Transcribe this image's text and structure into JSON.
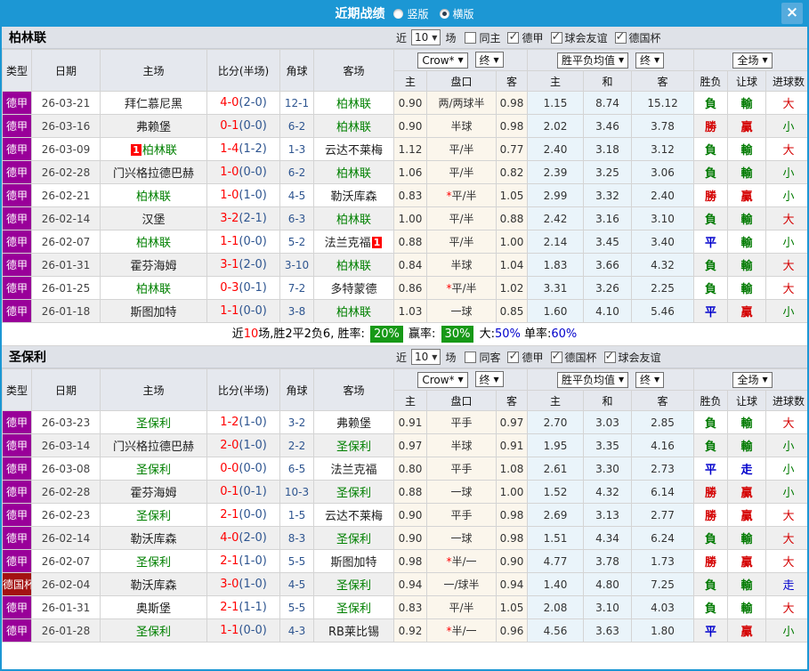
{
  "titlebar": {
    "title": "近期战绩",
    "radios": [
      {
        "label": "竖版",
        "selected": false
      },
      {
        "label": "横版",
        "selected": true
      }
    ],
    "close_glyph": "×"
  },
  "table_header": {
    "left": [
      "类型",
      "日期",
      "主场",
      "比分(半场)",
      "角球",
      "客场"
    ],
    "odds_sub": [
      "主",
      "盘口",
      "客"
    ],
    "avg_sub": [
      "主",
      "和",
      "客"
    ],
    "result_sub": [
      "胜负",
      "让球",
      "进球数"
    ],
    "dd_bookmaker": "Crow*",
    "dd_odds_time": "终",
    "dd_avg": "胜平负均值",
    "dd_avg_time": "终",
    "dd_scope": "全场",
    "arrow": "▼"
  },
  "sections": [
    {
      "team": "柏林联",
      "filters": {
        "near": "近",
        "count": "10",
        "games": "场",
        "same": {
          "label": "同主",
          "checked": false
        },
        "leagues": [
          {
            "label": "德甲",
            "checked": true
          },
          {
            "label": "球会友谊",
            "checked": true
          },
          {
            "label": "德国杯",
            "checked": true
          }
        ]
      },
      "rows": [
        {
          "type": "德甲",
          "cup": false,
          "date": "26-03-21",
          "home": "拜仁慕尼黑",
          "hf": false,
          "hb": null,
          "ft": "4-0",
          "ht": "(2-0)",
          "corner": "12-1",
          "away": "柏林联",
          "af": true,
          "ab": null,
          "odds": [
            "0.90",
            "两/两球半",
            "0.98"
          ],
          "star": false,
          "avg": [
            "1.15",
            "8.74",
            "15.12"
          ],
          "res": [
            [
              "負",
              "g"
            ],
            [
              "輸",
              "g"
            ],
            [
              "大",
              "r"
            ]
          ]
        },
        {
          "type": "德甲",
          "cup": false,
          "date": "26-03-16",
          "home": "弗赖堡",
          "hf": false,
          "hb": null,
          "ft": "0-1",
          "ht": "(0-0)",
          "corner": "6-2",
          "away": "柏林联",
          "af": true,
          "ab": null,
          "odds": [
            "0.90",
            "半球",
            "0.98"
          ],
          "star": false,
          "avg": [
            "2.02",
            "3.46",
            "3.78"
          ],
          "res": [
            [
              "勝",
              "r"
            ],
            [
              "贏",
              "r"
            ],
            [
              "小",
              "g"
            ]
          ]
        },
        {
          "type": "德甲",
          "cup": false,
          "date": "26-03-09",
          "home": "柏林联",
          "hf": true,
          "hb": "1",
          "ft": "1-4",
          "ht": "(1-2)",
          "corner": "1-3",
          "away": "云达不莱梅",
          "af": false,
          "ab": null,
          "odds": [
            "1.12",
            "平/半",
            "0.77"
          ],
          "star": false,
          "avg": [
            "2.40",
            "3.18",
            "3.12"
          ],
          "res": [
            [
              "負",
              "g"
            ],
            [
              "輸",
              "g"
            ],
            [
              "大",
              "r"
            ]
          ]
        },
        {
          "type": "德甲",
          "cup": false,
          "date": "26-02-28",
          "home": "门兴格拉德巴赫",
          "hf": false,
          "hb": null,
          "ft": "1-0",
          "ht": "(0-0)",
          "corner": "6-2",
          "away": "柏林联",
          "af": true,
          "ab": null,
          "odds": [
            "1.06",
            "平/半",
            "0.82"
          ],
          "star": false,
          "avg": [
            "2.39",
            "3.25",
            "3.06"
          ],
          "res": [
            [
              "負",
              "g"
            ],
            [
              "輸",
              "g"
            ],
            [
              "小",
              "g"
            ]
          ]
        },
        {
          "type": "德甲",
          "cup": false,
          "date": "26-02-21",
          "home": "柏林联",
          "hf": true,
          "hb": null,
          "ft": "1-0",
          "ht": "(1-0)",
          "corner": "4-5",
          "away": "勒沃库森",
          "af": false,
          "ab": null,
          "odds": [
            "0.83",
            "平/半",
            "1.05"
          ],
          "star": true,
          "avg": [
            "2.99",
            "3.32",
            "2.40"
          ],
          "res": [
            [
              "勝",
              "r"
            ],
            [
              "贏",
              "r"
            ],
            [
              "小",
              "g"
            ]
          ]
        },
        {
          "type": "德甲",
          "cup": false,
          "date": "26-02-14",
          "home": "汉堡",
          "hf": false,
          "hb": null,
          "ft": "3-2",
          "ht": "(2-1)",
          "corner": "6-3",
          "away": "柏林联",
          "af": true,
          "ab": null,
          "odds": [
            "1.00",
            "平/半",
            "0.88"
          ],
          "star": false,
          "avg": [
            "2.42",
            "3.16",
            "3.10"
          ],
          "res": [
            [
              "負",
              "g"
            ],
            [
              "輸",
              "g"
            ],
            [
              "大",
              "r"
            ]
          ]
        },
        {
          "type": "德甲",
          "cup": false,
          "date": "26-02-07",
          "home": "柏林联",
          "hf": true,
          "hb": null,
          "ft": "1-1",
          "ht": "(0-0)",
          "corner": "5-2",
          "away": "法兰克福",
          "af": false,
          "ab": "1",
          "odds": [
            "0.88",
            "平/半",
            "1.00"
          ],
          "star": false,
          "avg": [
            "2.14",
            "3.45",
            "3.40"
          ],
          "res": [
            [
              "平",
              "b"
            ],
            [
              "輸",
              "g"
            ],
            [
              "小",
              "g"
            ]
          ]
        },
        {
          "type": "德甲",
          "cup": false,
          "date": "26-01-31",
          "home": "霍芬海姆",
          "hf": false,
          "hb": null,
          "ft": "3-1",
          "ht": "(2-0)",
          "corner": "3-10",
          "away": "柏林联",
          "af": true,
          "ab": null,
          "odds": [
            "0.84",
            "半球",
            "1.04"
          ],
          "star": false,
          "avg": [
            "1.83",
            "3.66",
            "4.32"
          ],
          "res": [
            [
              "負",
              "g"
            ],
            [
              "輸",
              "g"
            ],
            [
              "大",
              "r"
            ]
          ]
        },
        {
          "type": "德甲",
          "cup": false,
          "date": "26-01-25",
          "home": "柏林联",
          "hf": true,
          "hb": null,
          "ft": "0-3",
          "ht": "(0-1)",
          "corner": "7-2",
          "away": "多特蒙德",
          "af": false,
          "ab": null,
          "odds": [
            "0.86",
            "平/半",
            "1.02"
          ],
          "star": true,
          "avg": [
            "3.31",
            "3.26",
            "2.25"
          ],
          "res": [
            [
              "負",
              "g"
            ],
            [
              "輸",
              "g"
            ],
            [
              "大",
              "r"
            ]
          ]
        },
        {
          "type": "德甲",
          "cup": false,
          "date": "26-01-18",
          "home": "斯图加特",
          "hf": false,
          "hb": null,
          "ft": "1-1",
          "ht": "(0-0)",
          "corner": "3-8",
          "away": "柏林联",
          "af": true,
          "ab": null,
          "odds": [
            "1.03",
            "一球",
            "0.85"
          ],
          "star": false,
          "avg": [
            "1.60",
            "4.10",
            "5.46"
          ],
          "res": [
            [
              "平",
              "b"
            ],
            [
              "贏",
              "r"
            ],
            [
              "小",
              "g"
            ]
          ]
        }
      ],
      "summary": [
        [
          "近",
          "k"
        ],
        [
          "10",
          "r"
        ],
        [
          "场,胜2平2负6, 胜率: ",
          "k"
        ],
        [
          "20%",
          "badge"
        ],
        [
          " 赢率: ",
          "k"
        ],
        [
          "30%",
          "badge"
        ],
        [
          " 大:",
          "k"
        ],
        [
          "50%",
          "b"
        ],
        [
          " 单率:",
          "k"
        ],
        [
          "60%",
          "b"
        ]
      ]
    },
    {
      "team": "圣保利",
      "filters": {
        "near": "近",
        "count": "10",
        "games": "场",
        "same": {
          "label": "同客",
          "checked": false
        },
        "leagues": [
          {
            "label": "德甲",
            "checked": true
          },
          {
            "label": "德国杯",
            "checked": true
          },
          {
            "label": "球会友谊",
            "checked": true
          }
        ]
      },
      "rows": [
        {
          "type": "德甲",
          "cup": false,
          "date": "26-03-23",
          "home": "圣保利",
          "hf": true,
          "hb": null,
          "ft": "1-2",
          "ht": "(1-0)",
          "corner": "3-2",
          "away": "弗赖堡",
          "af": false,
          "ab": null,
          "odds": [
            "0.91",
            "平手",
            "0.97"
          ],
          "star": false,
          "avg": [
            "2.70",
            "3.03",
            "2.85"
          ],
          "res": [
            [
              "負",
              "g"
            ],
            [
              "輸",
              "g"
            ],
            [
              "大",
              "r"
            ]
          ]
        },
        {
          "type": "德甲",
          "cup": false,
          "date": "26-03-14",
          "home": "门兴格拉德巴赫",
          "hf": false,
          "hb": null,
          "ft": "2-0",
          "ht": "(1-0)",
          "corner": "2-2",
          "away": "圣保利",
          "af": true,
          "ab": null,
          "odds": [
            "0.97",
            "半球",
            "0.91"
          ],
          "star": false,
          "avg": [
            "1.95",
            "3.35",
            "4.16"
          ],
          "res": [
            [
              "負",
              "g"
            ],
            [
              "輸",
              "g"
            ],
            [
              "小",
              "g"
            ]
          ]
        },
        {
          "type": "德甲",
          "cup": false,
          "date": "26-03-08",
          "home": "圣保利",
          "hf": true,
          "hb": null,
          "ft": "0-0",
          "ht": "(0-0)",
          "corner": "6-5",
          "away": "法兰克福",
          "af": false,
          "ab": null,
          "odds": [
            "0.80",
            "平手",
            "1.08"
          ],
          "star": false,
          "avg": [
            "2.61",
            "3.30",
            "2.73"
          ],
          "res": [
            [
              "平",
              "b"
            ],
            [
              "走",
              "b"
            ],
            [
              "小",
              "g"
            ]
          ]
        },
        {
          "type": "德甲",
          "cup": false,
          "date": "26-02-28",
          "home": "霍芬海姆",
          "hf": false,
          "hb": null,
          "ft": "0-1",
          "ht": "(0-1)",
          "corner": "10-3",
          "away": "圣保利",
          "af": true,
          "ab": null,
          "odds": [
            "0.88",
            "一球",
            "1.00"
          ],
          "star": false,
          "avg": [
            "1.52",
            "4.32",
            "6.14"
          ],
          "res": [
            [
              "勝",
              "r"
            ],
            [
              "贏",
              "r"
            ],
            [
              "小",
              "g"
            ]
          ]
        },
        {
          "type": "德甲",
          "cup": false,
          "date": "26-02-23",
          "home": "圣保利",
          "hf": true,
          "hb": null,
          "ft": "2-1",
          "ht": "(0-0)",
          "corner": "1-5",
          "away": "云达不莱梅",
          "af": false,
          "ab": null,
          "odds": [
            "0.90",
            "平手",
            "0.98"
          ],
          "star": false,
          "avg": [
            "2.69",
            "3.13",
            "2.77"
          ],
          "res": [
            [
              "勝",
              "r"
            ],
            [
              "贏",
              "r"
            ],
            [
              "大",
              "r"
            ]
          ]
        },
        {
          "type": "德甲",
          "cup": false,
          "date": "26-02-14",
          "home": "勒沃库森",
          "hf": false,
          "hb": null,
          "ft": "4-0",
          "ht": "(2-0)",
          "corner": "8-3",
          "away": "圣保利",
          "af": true,
          "ab": null,
          "odds": [
            "0.90",
            "一球",
            "0.98"
          ],
          "star": false,
          "avg": [
            "1.51",
            "4.34",
            "6.24"
          ],
          "res": [
            [
              "負",
              "g"
            ],
            [
              "輸",
              "g"
            ],
            [
              "大",
              "r"
            ]
          ]
        },
        {
          "type": "德甲",
          "cup": false,
          "date": "26-02-07",
          "home": "圣保利",
          "hf": true,
          "hb": null,
          "ft": "2-1",
          "ht": "(1-0)",
          "corner": "5-5",
          "away": "斯图加特",
          "af": false,
          "ab": null,
          "odds": [
            "0.98",
            "半/一",
            "0.90"
          ],
          "star": true,
          "avg": [
            "4.77",
            "3.78",
            "1.73"
          ],
          "res": [
            [
              "勝",
              "r"
            ],
            [
              "贏",
              "r"
            ],
            [
              "大",
              "r"
            ]
          ]
        },
        {
          "type": "德国杯",
          "cup": true,
          "date": "26-02-04",
          "home": "勒沃库森",
          "hf": false,
          "hb": null,
          "ft": "3-0",
          "ht": "(1-0)",
          "corner": "4-5",
          "away": "圣保利",
          "af": true,
          "ab": null,
          "odds": [
            "0.94",
            "一/球半",
            "0.94"
          ],
          "star": false,
          "avg": [
            "1.40",
            "4.80",
            "7.25"
          ],
          "res": [
            [
              "負",
              "g"
            ],
            [
              "輸",
              "g"
            ],
            [
              "走",
              "b"
            ]
          ]
        },
        {
          "type": "德甲",
          "cup": false,
          "date": "26-01-31",
          "home": "奥斯堡",
          "hf": false,
          "hb": null,
          "ft": "2-1",
          "ht": "(1-1)",
          "corner": "5-5",
          "away": "圣保利",
          "af": true,
          "ab": null,
          "odds": [
            "0.83",
            "平/半",
            "1.05"
          ],
          "star": false,
          "avg": [
            "2.08",
            "3.10",
            "4.03"
          ],
          "res": [
            [
              "負",
              "g"
            ],
            [
              "輸",
              "g"
            ],
            [
              "大",
              "r"
            ]
          ]
        },
        {
          "type": "德甲",
          "cup": false,
          "date": "26-01-28",
          "home": "圣保利",
          "hf": true,
          "hb": null,
          "ft": "1-1",
          "ht": "(0-0)",
          "corner": "4-3",
          "away": "RB莱比锡",
          "af": false,
          "ab": null,
          "odds": [
            "0.92",
            "半/一",
            "0.96"
          ],
          "star": true,
          "avg": [
            "4.56",
            "3.63",
            "1.80"
          ],
          "res": [
            [
              "平",
              "b"
            ],
            [
              "贏",
              "r"
            ],
            [
              "小",
              "g"
            ]
          ]
        }
      ],
      "summary": null
    }
  ]
}
